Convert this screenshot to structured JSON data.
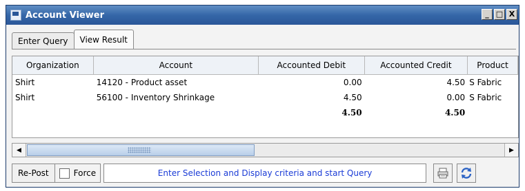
{
  "window": {
    "title": "Account Viewer",
    "buttons": {
      "minimize": "_",
      "maximize": "□",
      "close": "X"
    }
  },
  "tabs": [
    {
      "label": "Enter Query",
      "active": false
    },
    {
      "label": "View Result",
      "active": true
    }
  ],
  "table": {
    "headers": [
      "Organization",
      "Account",
      "Accounted Debit",
      "Accounted Credit",
      "Product"
    ],
    "rows": [
      {
        "organization": "Shirt",
        "account": "14120 - Product asset",
        "debit": "0.00",
        "credit": "4.50",
        "product": "S Fabric"
      },
      {
        "organization": "Shirt",
        "account": "56100 - Inventory Shrinkage",
        "debit": "4.50",
        "credit": "0.00",
        "product": "S Fabric"
      }
    ],
    "totals": {
      "debit": "4.50",
      "credit": "4.50"
    }
  },
  "scrollbar": {
    "left_arrow": "◀",
    "right_arrow": "▶"
  },
  "bottom": {
    "repost_label": "Re-Post",
    "force_label": "Force",
    "force_checked": false,
    "status_text": "Enter Selection and Display criteria and start Query"
  },
  "colors": {
    "titlebar": "#3567a8",
    "status_text": "#1a3bd6"
  }
}
